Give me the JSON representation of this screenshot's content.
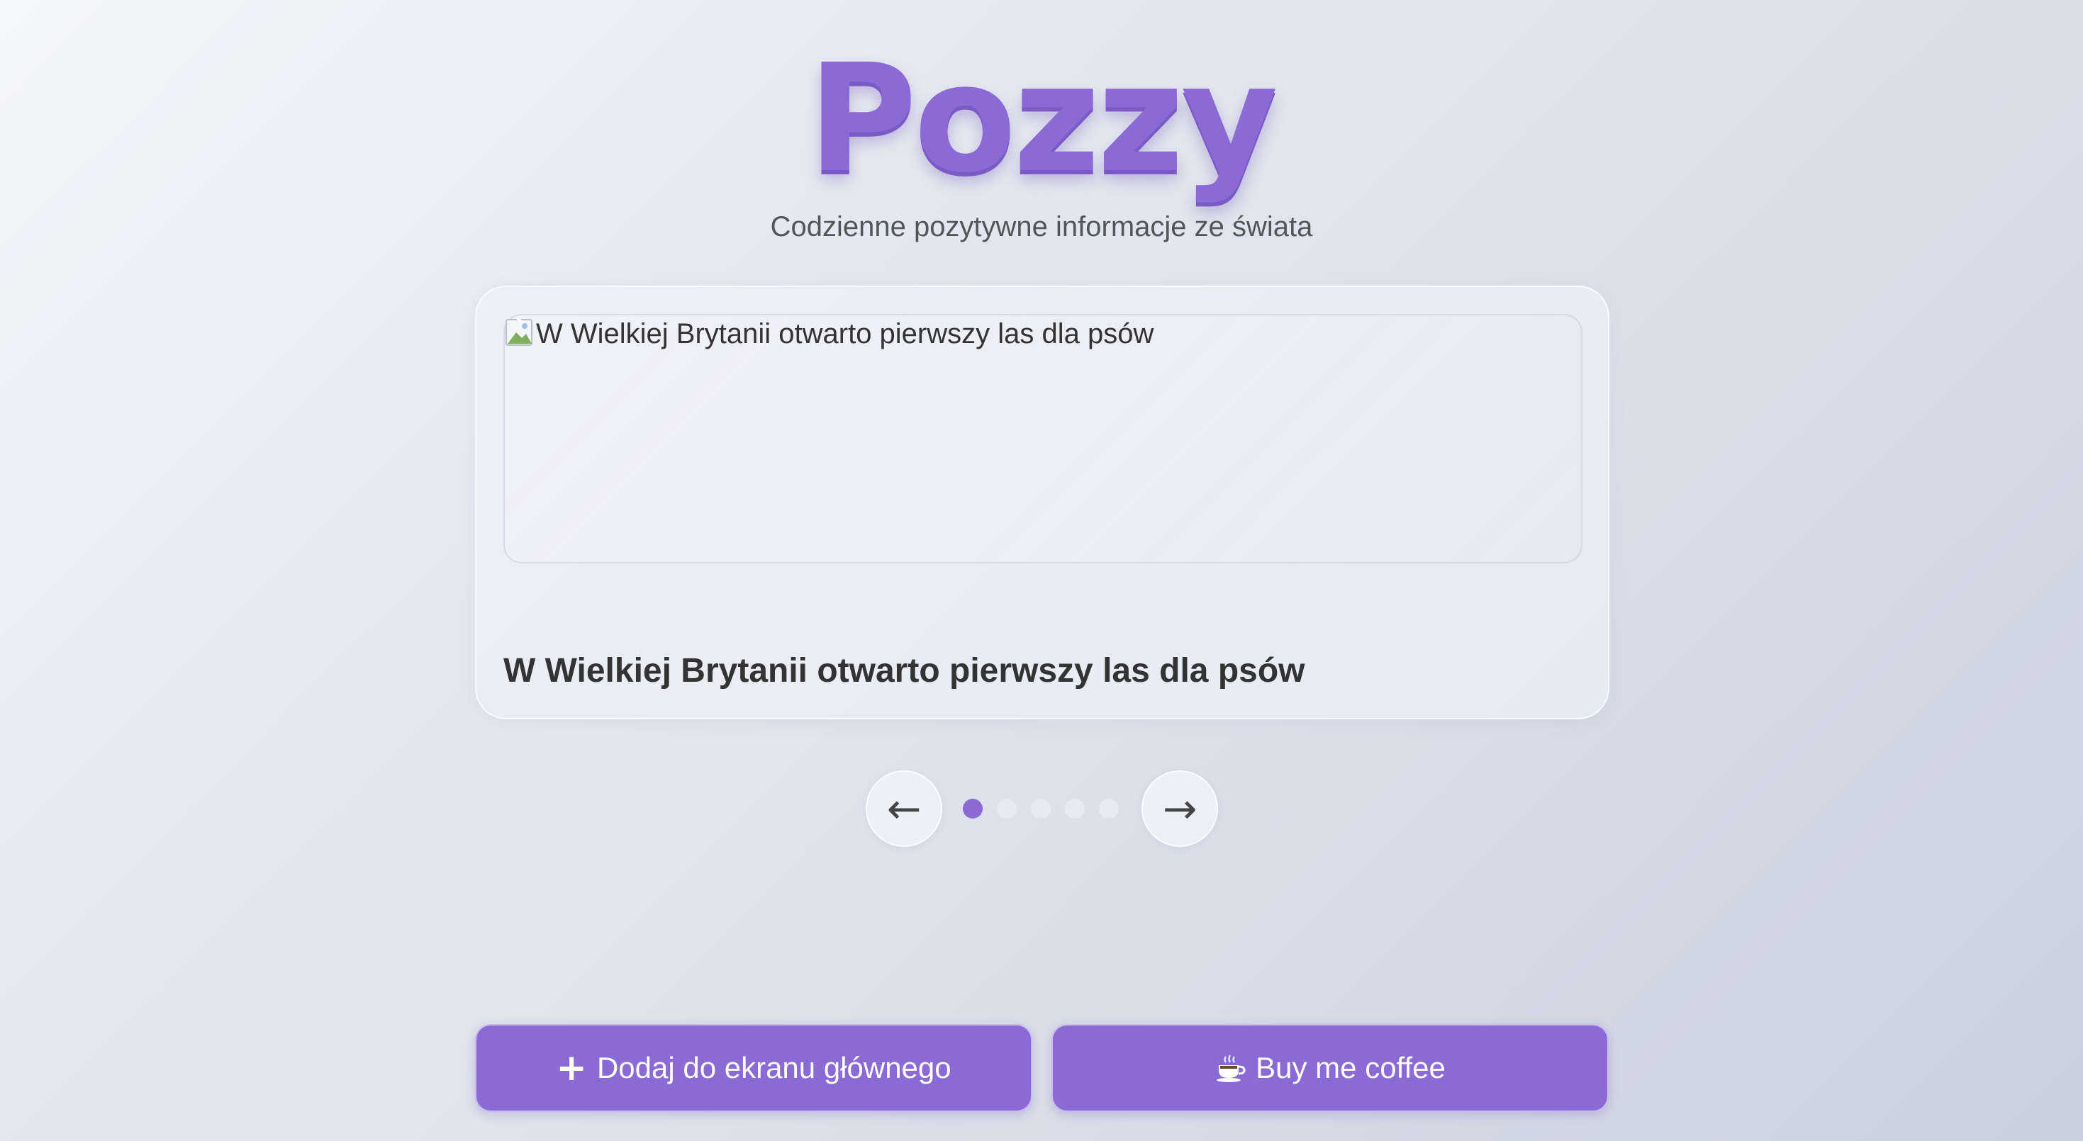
{
  "app": {
    "logo": "Pozzy",
    "subtitle": "Codzienne pozytywne informacje ze świata"
  },
  "article": {
    "image_alt": "W Wielkiej Brytanii otwarto pierwszy las dla psów",
    "title": "W Wielkiej Brytanii otwarto pierwszy las dla psów"
  },
  "carousel": {
    "prev_label": "←",
    "next_label": "→",
    "total": 5,
    "active_index": 0
  },
  "actions": {
    "add_icon": "+",
    "add_label": "Dodaj do ekranu głównego",
    "coffee_icon": "coffee-cup-icon",
    "coffee_label": "Buy me coffee"
  },
  "colors": {
    "accent": "#8b6ad6",
    "dot_inactive": "#e8eaf1",
    "text": "#333333"
  }
}
